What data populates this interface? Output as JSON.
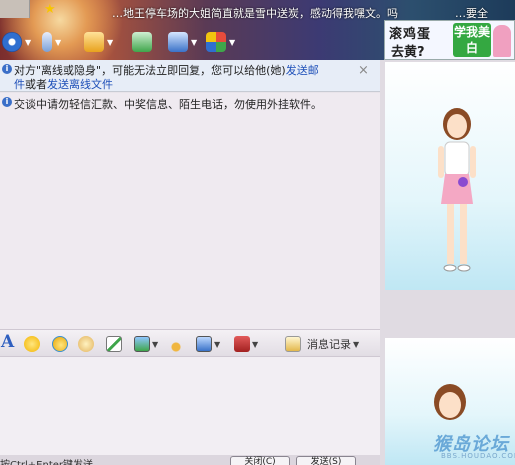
{
  "banner": {
    "marquee": "…地王停车场的大姐简直就是雪中送炭，感动得我嘿文。吗",
    "marquee_tail": "…要全",
    "icons": [
      "star-icon"
    ]
  },
  "toolbar": {
    "buttons": [
      {
        "name": "video-icon",
        "color": "#2f6fd0"
      },
      {
        "name": "microphone-icon",
        "color": "#7aa0d8"
      },
      {
        "name": "send-file-icon",
        "color": "#e8a21d"
      },
      {
        "name": "add-friend-icon",
        "color": "#3fa64b"
      },
      {
        "name": "remote-assist-icon",
        "color": "#3a72c8"
      },
      {
        "name": "apps-icon",
        "color": "#d9a23a"
      }
    ]
  },
  "ad": {
    "line1": "滚鸡蛋",
    "line2": "去黄?",
    "badge": "学我美白"
  },
  "notice": {
    "line1_prefix": "对方\"离线或隐身\"，可能无法立即回复，您可以给他(她)",
    "line1_link": "发送邮",
    "line2_link_cont": "件",
    "line2_mid": "或者",
    "line2_link": "发送离线文件",
    "close": "×"
  },
  "messages": {
    "system_text": "交谈中请勿轻信汇款、中奖信息、陌生电话，勿使用外挂软件。"
  },
  "format_toolbar": {
    "font_label": "A",
    "history_label": "消息记录",
    "icons": [
      "smiley-icon",
      "wink-icon",
      "magic-face-icon",
      "screenshot-icon",
      "image-icon",
      "music-icon",
      "screen-icon",
      "gift-icon"
    ]
  },
  "footer": {
    "hint": "按Ctrl+Enter键发送",
    "close_button": "关闭(C)",
    "send_button": "发送(S)"
  },
  "watermark": {
    "title": "猴岛论坛",
    "url": "BBS.HOUDAO.COM"
  }
}
